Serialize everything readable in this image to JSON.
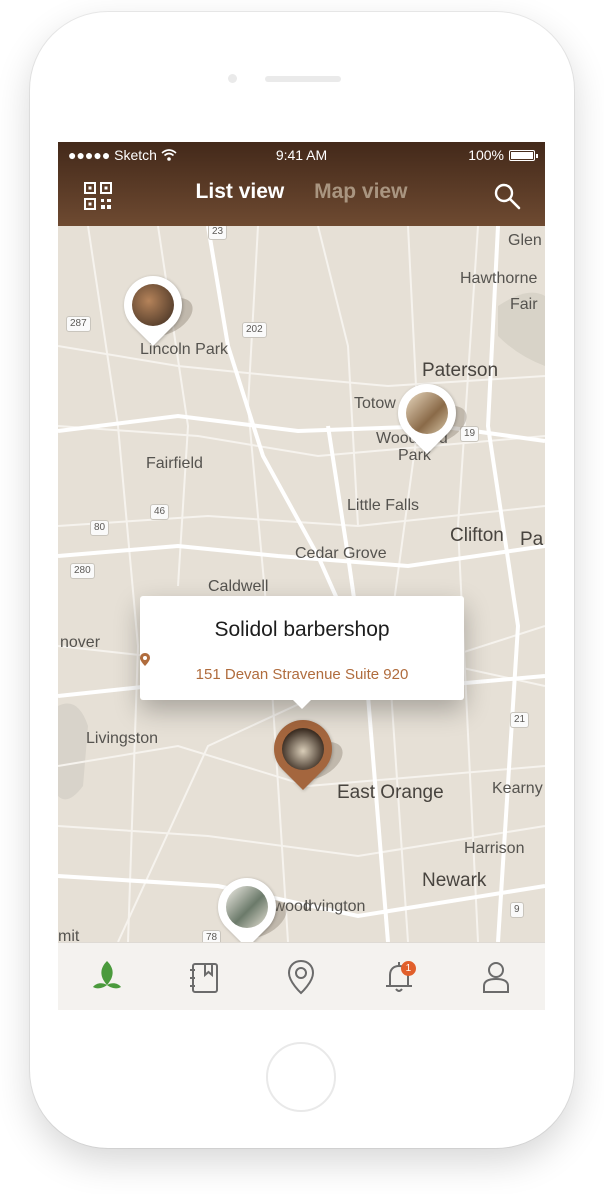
{
  "status_bar": {
    "carrier": "●●●●● Sketch",
    "time": "9:41 AM",
    "battery": "100%"
  },
  "header": {
    "tabs": [
      {
        "label": "List view",
        "active": true
      },
      {
        "label": "Map view",
        "active": false
      }
    ],
    "icons": {
      "left": "qr-code-icon",
      "right": "search-icon"
    }
  },
  "map": {
    "places": [
      "Glen",
      "Hawthorne",
      "Fair",
      "Lincoln Park",
      "Paterson",
      "Totow",
      "Woodland",
      "Park",
      "Fairfield",
      "Little Falls",
      "Clifton",
      "Pa",
      "Cedar Grove",
      "Caldwell",
      "nover",
      "Livingston",
      "East Orange",
      "Kearny",
      "Harrison",
      "Newark",
      "Maplewood",
      "Irvington",
      "mit"
    ],
    "road_shields": [
      "287",
      "23",
      "202",
      "19",
      "46",
      "80",
      "280",
      "21",
      "9",
      "78"
    ]
  },
  "callout": {
    "title": "Solidol barbershop",
    "address": "151 Devan Stravenue Suite 920"
  },
  "tab_bar": {
    "items": [
      "leaf-icon",
      "bookmark-book-icon",
      "location-pin-icon",
      "bell-icon",
      "profile-icon"
    ],
    "notification_count": "1",
    "active_color": "#4a9a3c"
  },
  "colors": {
    "header_dark": "#43291a",
    "header_light": "#6e4a31",
    "accent": "#a4663e",
    "map_background": "#e6e0d6"
  }
}
